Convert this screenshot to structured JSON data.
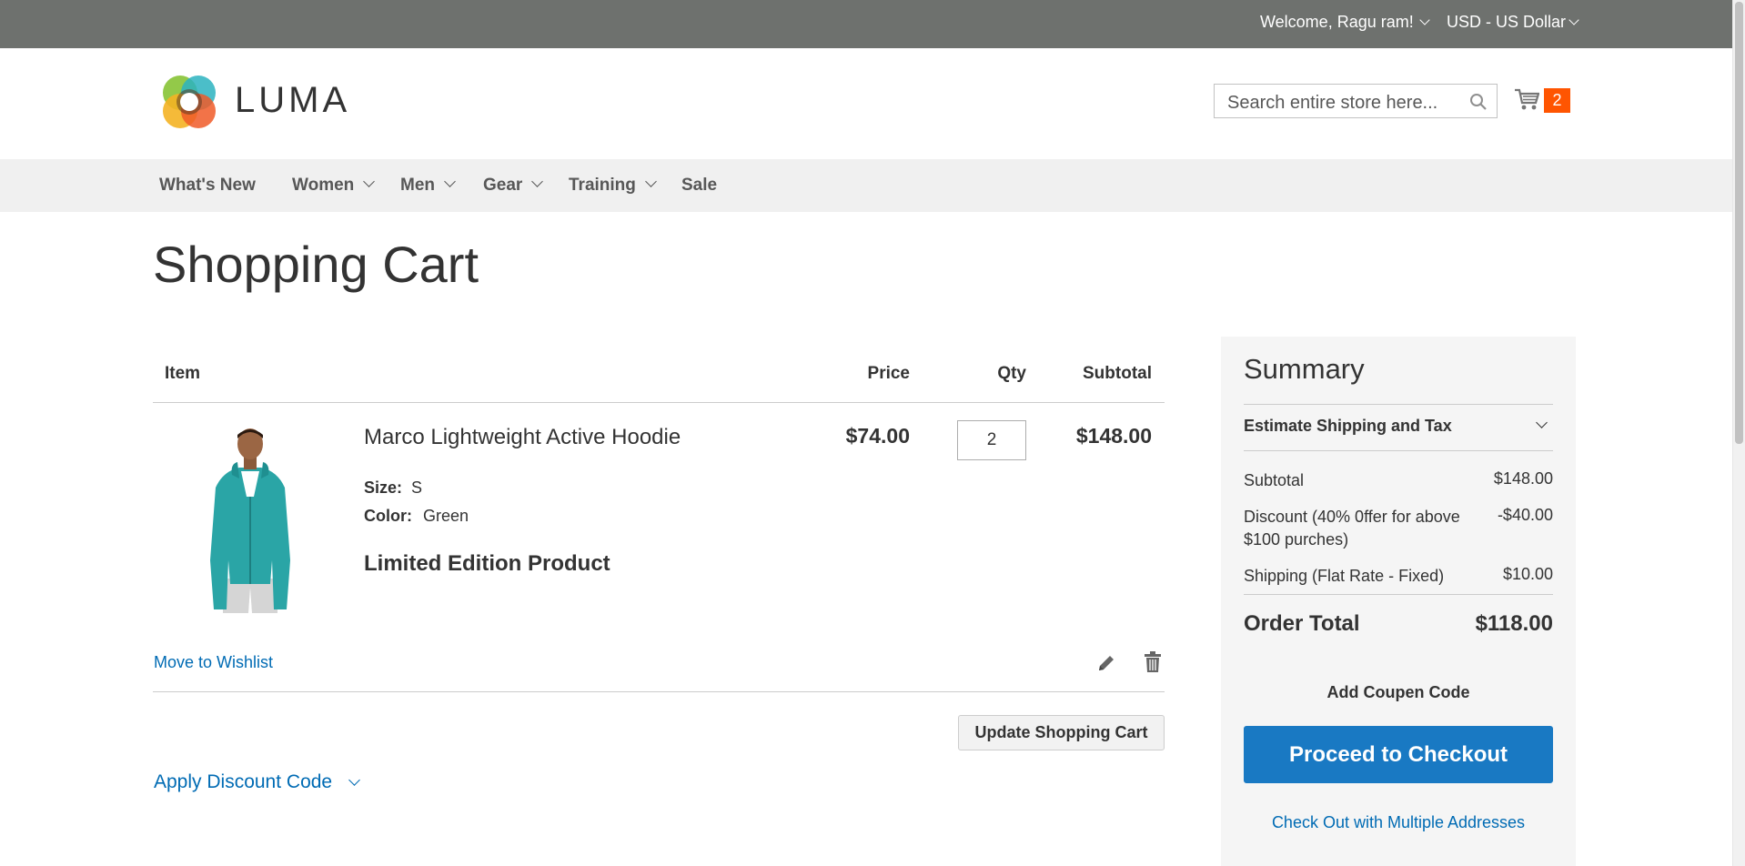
{
  "header": {
    "welcome": "Welcome, Ragu ram!",
    "currency": "USD - US Dollar",
    "logo_text": "LUMA",
    "search_placeholder": "Search entire store here...",
    "cart_count": "2"
  },
  "nav": {
    "items": [
      {
        "label": "What's New",
        "has_dropdown": false
      },
      {
        "label": "Women",
        "has_dropdown": true
      },
      {
        "label": "Men",
        "has_dropdown": true
      },
      {
        "label": "Gear",
        "has_dropdown": true
      },
      {
        "label": "Training",
        "has_dropdown": true
      },
      {
        "label": "Sale",
        "has_dropdown": false
      }
    ]
  },
  "page": {
    "title": "Shopping Cart"
  },
  "cart": {
    "headers": {
      "item": "Item",
      "price": "Price",
      "qty": "Qty",
      "subtotal": "Subtotal"
    },
    "items": [
      {
        "name": "Marco Lightweight Active Hoodie",
        "options": [
          {
            "label": "Size:",
            "value": "S"
          },
          {
            "label": "Color:",
            "value": "Green"
          }
        ],
        "note": "Limited Edition Product",
        "price": "$74.00",
        "qty": "2",
        "subtotal": "$148.00"
      }
    ],
    "move_to_wishlist": "Move to Wishlist",
    "update_button": "Update Shopping Cart",
    "apply_discount": "Apply Discount Code"
  },
  "summary": {
    "title": "Summary",
    "estimate_label": "Estimate Shipping and Tax",
    "rows": [
      {
        "label": "Subtotal",
        "value": "$148.00"
      },
      {
        "label": "Discount (40% 0ffer for above $100 purches)",
        "value": "-$40.00"
      },
      {
        "label": "Shipping (Flat Rate - Fixed)",
        "value": "$10.00"
      }
    ],
    "order_total_label": "Order Total",
    "order_total_value": "$118.00",
    "coupon_label": "Add Coupen Code",
    "checkout_button": "Proceed to Checkout",
    "multi_address_link": "Check Out with Multiple Addresses"
  },
  "colors": {
    "top_bar": "#6e716e",
    "nav_bg": "#f0f0f0",
    "link": "#006bb4",
    "checkout_button": "#1979c3",
    "cart_badge": "#ff5501",
    "summary_bg": "#f5f5f5"
  },
  "icons": [
    "chevron-down-icon",
    "search-icon",
    "cart-icon",
    "edit-icon",
    "delete-icon",
    "luma-logo"
  ]
}
